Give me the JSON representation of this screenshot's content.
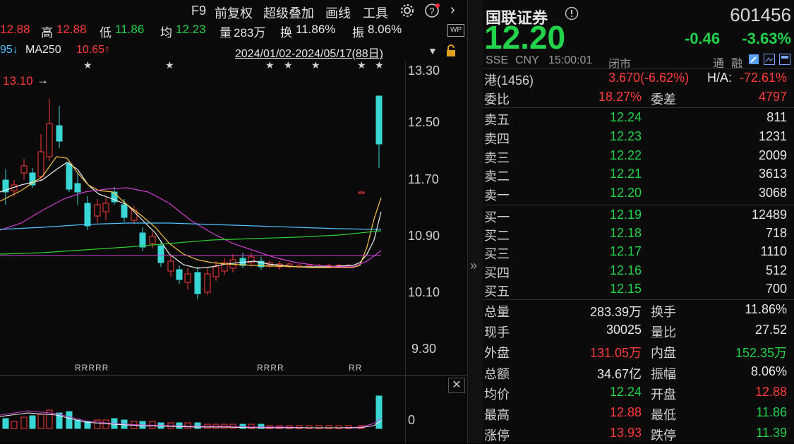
{
  "toolbar": {
    "f9": "F9",
    "restore_rights": "前复权",
    "overlay": "超级叠加",
    "draw": "画线",
    "tools": "工具"
  },
  "infoline": {
    "open_value": "12.88",
    "high_label": "高",
    "high_value": "12.88",
    "low_label": "低",
    "low_value": "11.86",
    "avg_label": "均",
    "avg_value": "12.23",
    "vol_label": "量",
    "vol_value": "283万",
    "turnover_label": "换",
    "turnover_value": "11.86%",
    "amp_label": "振",
    "amp_value": "8.06%",
    "wp": "WP"
  },
  "maline": {
    "prev_tail": "95↓",
    "ma_label": "MA250",
    "ma_value": "10.65↑",
    "range": "2024/01/02-2024/05/17(88日)"
  },
  "chart": {
    "y_labels": [
      "13.30",
      "12.50",
      "11.70",
      "10.90",
      "10.10",
      "9.30"
    ],
    "max_marker": "13.10",
    "vol_axis_label": "0",
    "r_marks_a": "RRRRR",
    "r_marks_b": "RRRR",
    "r_marks_c": "RR",
    "colors": {
      "up": "#ff3b3b",
      "down": "#3ad6d6",
      "ma5": "#f0f0f0",
      "ma10": "#f5c542",
      "ma20": "#d040d0",
      "ma60": "#2ed12e",
      "ma250": "#52c0ff"
    }
  },
  "quote": {
    "name": "国联证券",
    "code": "601456",
    "price": "12.20",
    "change": "-0.46",
    "change_pct": "-3.63%",
    "market": "SSE",
    "currency": "CNY",
    "time": "15:00:01",
    "status": "闭市",
    "tong": "通",
    "rong": "融",
    "hk_label": "港(1456)",
    "hk_price": "3.670(-6.62%)",
    "ha_label": "H/A:",
    "ha_value": "-72.61%",
    "weibi_label": "委比",
    "weibi_value": "18.27%",
    "weicha_label": "委差",
    "weicha_value": "4797",
    "asks": [
      {
        "label": "卖五",
        "price": "12.24",
        "vol": "811"
      },
      {
        "label": "卖四",
        "price": "12.23",
        "vol": "1231"
      },
      {
        "label": "卖三",
        "price": "12.22",
        "vol": "2009"
      },
      {
        "label": "卖二",
        "price": "12.21",
        "vol": "3613"
      },
      {
        "label": "卖一",
        "price": "12.20",
        "vol": "3068"
      }
    ],
    "bids": [
      {
        "label": "买一",
        "price": "12.19",
        "vol": "12489"
      },
      {
        "label": "买二",
        "price": "12.18",
        "vol": "718"
      },
      {
        "label": "买三",
        "price": "12.17",
        "vol": "1110"
      },
      {
        "label": "买四",
        "price": "12.16",
        "vol": "512"
      },
      {
        "label": "买五",
        "price": "12.15",
        "vol": "700"
      }
    ],
    "stats": [
      {
        "l1": "总量",
        "v1": "283.39万",
        "l2": "换手",
        "v2": "11.86%"
      },
      {
        "l1": "现手",
        "v1": "30025",
        "l2": "量比",
        "v2": "27.52"
      },
      {
        "l1": "外盘",
        "v1": "131.05万",
        "l2": "内盘",
        "v2": "152.35万"
      },
      {
        "l1": "总额",
        "v1": "34.67亿",
        "l2": "振幅",
        "v2": "8.06%"
      },
      {
        "l1": "均价",
        "v1": "12.24",
        "l2": "开盘",
        "v2": "12.88"
      },
      {
        "l1": "最高",
        "v1": "12.88",
        "l2": "最低",
        "v2": "11.86"
      },
      {
        "l1": "涨停",
        "v1": "13.93",
        "l2": "跌停",
        "v2": "11.39"
      }
    ]
  }
}
